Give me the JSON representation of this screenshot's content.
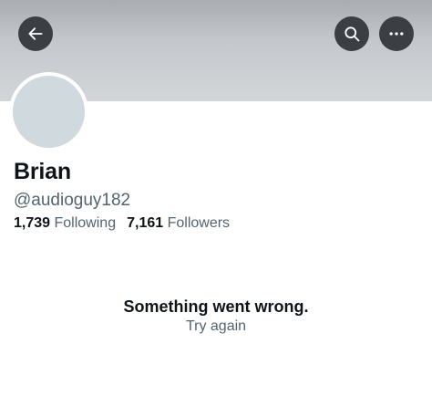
{
  "header": {
    "back_icon": "arrow-left-icon",
    "search_icon": "search-icon",
    "more_icon": "more-horizontal-icon"
  },
  "profile": {
    "name": "Brian",
    "handle": "@audioguy182",
    "following_count": "1,739",
    "following_label": "Following",
    "followers_count": "7,161",
    "followers_label": "Followers"
  },
  "error": {
    "title": "Something went wrong.",
    "retry_label": "Try again"
  },
  "colors": {
    "banner": "#c4c8cc",
    "avatar": "#cfd9de",
    "text_primary": "#0f1419",
    "text_secondary": "#536471",
    "icon_button_bg": "#3b3f43"
  }
}
